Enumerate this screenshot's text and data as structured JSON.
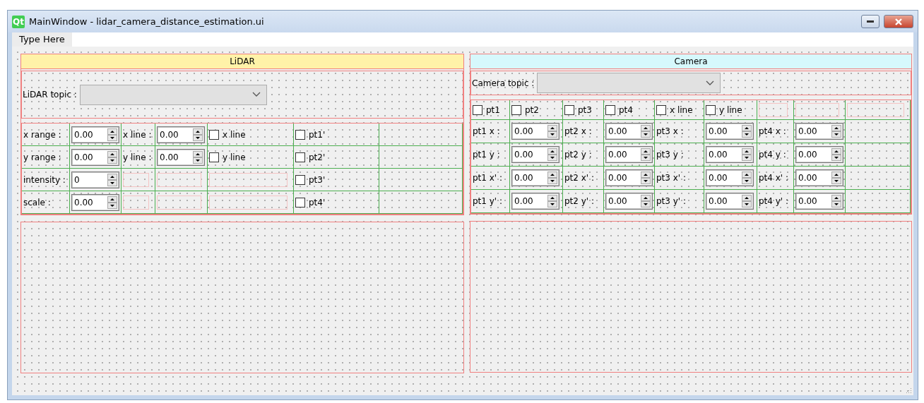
{
  "window": {
    "logo": "Qt",
    "title": "MainWindow - lidar_camera_distance_estimation.ui"
  },
  "menu": [
    "Type Here"
  ],
  "lidar": {
    "title": "LiDAR",
    "topic_label": "LiDAR topic :",
    "rows": [
      {
        "cells": [
          {
            "kind": "label",
            "text": "x range :"
          },
          {
            "kind": "spinbox",
            "value": "0.00"
          },
          {
            "kind": "label",
            "text": "x line :"
          },
          {
            "kind": "spinbox",
            "value": "0.00"
          },
          {
            "kind": "checkbox",
            "label": "x line",
            "checked": false
          },
          {
            "kind": "checkbox",
            "label": "pt1'",
            "checked": false
          },
          {
            "kind": "blank"
          }
        ]
      },
      {
        "cells": [
          {
            "kind": "label",
            "text": "y range :"
          },
          {
            "kind": "spinbox",
            "value": "0.00"
          },
          {
            "kind": "label",
            "text": "y line :"
          },
          {
            "kind": "spinbox",
            "value": "0.00"
          },
          {
            "kind": "checkbox",
            "label": "y line",
            "checked": false
          },
          {
            "kind": "checkbox",
            "label": "pt2'",
            "checked": false
          },
          {
            "kind": "blank"
          }
        ]
      },
      {
        "cells": [
          {
            "kind": "label",
            "text": "intensity :"
          },
          {
            "kind": "spinbox",
            "value": "0"
          },
          {
            "kind": "spacer"
          },
          {
            "kind": "spacer"
          },
          {
            "kind": "spacer"
          },
          {
            "kind": "checkbox",
            "label": "pt3'",
            "checked": false
          },
          {
            "kind": "blank"
          }
        ]
      },
      {
        "cells": [
          {
            "kind": "label",
            "text": "scale :"
          },
          {
            "kind": "spinbox",
            "value": "0.00"
          },
          {
            "kind": "spacer"
          },
          {
            "kind": "spacer"
          },
          {
            "kind": "spacer"
          },
          {
            "kind": "checkbox",
            "label": "pt4'",
            "checked": false
          },
          {
            "kind": "blank"
          }
        ]
      }
    ]
  },
  "camera": {
    "title": "Camera",
    "topic_label": "Camera topic :",
    "rows": [
      {
        "cells": [
          {
            "kind": "checkbox",
            "label": "pt1",
            "checked": false
          },
          {
            "kind": "checkbox",
            "label": "pt2",
            "checked": false
          },
          {
            "kind": "checkbox",
            "label": "pt3",
            "checked": false
          },
          {
            "kind": "checkbox",
            "label": "pt4",
            "checked": false
          },
          {
            "kind": "checkbox",
            "label": "x line",
            "checked": false
          },
          {
            "kind": "checkbox",
            "label": "y line",
            "checked": false
          },
          {
            "kind": "spacer"
          },
          {
            "kind": "spacer"
          },
          {
            "kind": "spacer"
          }
        ]
      },
      {
        "cells": [
          {
            "kind": "label",
            "text": "pt1 x :"
          },
          {
            "kind": "spinbox",
            "value": "0.00"
          },
          {
            "kind": "label",
            "text": "pt2 x :"
          },
          {
            "kind": "spinbox",
            "value": "0.00"
          },
          {
            "kind": "label",
            "text": "pt3 x :"
          },
          {
            "kind": "spinbox",
            "value": "0.00"
          },
          {
            "kind": "label",
            "text": "pt4 x :"
          },
          {
            "kind": "spinbox",
            "value": "0.00"
          },
          {
            "kind": "blank"
          }
        ]
      },
      {
        "cells": [
          {
            "kind": "label",
            "text": "pt1 y :"
          },
          {
            "kind": "spinbox",
            "value": "0.00"
          },
          {
            "kind": "label",
            "text": "pt2 y :"
          },
          {
            "kind": "spinbox",
            "value": "0.00"
          },
          {
            "kind": "label",
            "text": "pt3 y :"
          },
          {
            "kind": "spinbox",
            "value": "0.00"
          },
          {
            "kind": "label",
            "text": "pt4 y :"
          },
          {
            "kind": "spinbox",
            "value": "0.00"
          },
          {
            "kind": "blank"
          }
        ]
      },
      {
        "cells": [
          {
            "kind": "label",
            "text": "pt1 x' :"
          },
          {
            "kind": "spinbox",
            "value": "0.00"
          },
          {
            "kind": "label",
            "text": "pt2 x' :"
          },
          {
            "kind": "spinbox",
            "value": "0.00"
          },
          {
            "kind": "label",
            "text": "pt3 x' :"
          },
          {
            "kind": "spinbox",
            "value": "0.00"
          },
          {
            "kind": "label",
            "text": "pt4 x' :"
          },
          {
            "kind": "spinbox",
            "value": "0.00"
          },
          {
            "kind": "blank"
          }
        ]
      },
      {
        "cells": [
          {
            "kind": "label",
            "text": "pt1 y' :"
          },
          {
            "kind": "spinbox",
            "value": "0.00"
          },
          {
            "kind": "label",
            "text": "pt2 y' :"
          },
          {
            "kind": "spinbox",
            "value": "0.00"
          },
          {
            "kind": "label",
            "text": "pt3 y' :"
          },
          {
            "kind": "spinbox",
            "value": "0.00"
          },
          {
            "kind": "label",
            "text": "pt4 y' :"
          },
          {
            "kind": "spinbox",
            "value": "0.00"
          },
          {
            "kind": "blank"
          }
        ]
      }
    ]
  }
}
